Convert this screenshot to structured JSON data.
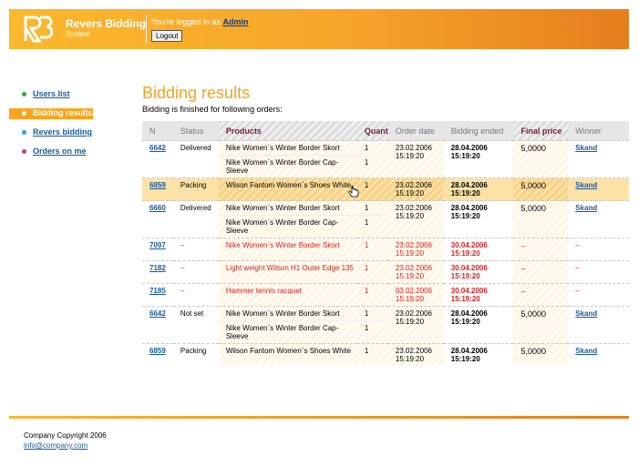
{
  "header": {
    "brand_title": "Revers Bidding",
    "brand_subtitle": "System",
    "logged_in_prefix": "You're logged in as",
    "user": "Admin",
    "logout_label": "Logout"
  },
  "nav": {
    "items": [
      {
        "label": "Users list",
        "color": "#3aa63a"
      },
      {
        "label": "Bidding results",
        "color": "#ffffff",
        "active": true
      },
      {
        "label": "Revers bidding",
        "color": "#2aa7d8"
      },
      {
        "label": "Orders on me",
        "color": "#a5479c"
      }
    ]
  },
  "main": {
    "title": "Bidding results",
    "subtitle": "Bidding is finished for following orders:",
    "columns": [
      "N",
      "Status",
      "Products",
      "Quant",
      "Order date",
      "Bidding ended",
      "Final price",
      "Winner"
    ]
  },
  "orders": [
    {
      "n": "6642",
      "status": "Delivered",
      "products": [
        "Nike Women`s Winter Border Skort",
        "Nike Women`s Winter Border Cap-Sleeve"
      ],
      "quant": [
        "1",
        "1"
      ],
      "order_date": "23.02.2006",
      "order_time": "15:19:20",
      "ended_date": "28.04.2006",
      "ended_time": "15:19:20",
      "price": "5,0000",
      "winner": "Skand"
    },
    {
      "n": "6859",
      "status": "Packing",
      "products": [
        "Wilson Fantom Women`s Shoes White"
      ],
      "quant": [
        "1"
      ],
      "order_date": "23.02.2006",
      "order_time": "15:19:20",
      "ended_date": "28.04.2006",
      "ended_time": "15:19:20",
      "price": "5,0000",
      "winner": "Skand",
      "selected": true
    },
    {
      "n": "6660",
      "status": "Delivered",
      "products": [
        "Nike Women`s Winter Border Skort",
        "Nike Women`s Winter Border Cap-Sleeve"
      ],
      "quant": [
        "1",
        "1"
      ],
      "order_date": "23.02.2006",
      "order_time": "15:19:20",
      "ended_date": "28.04.2006",
      "ended_time": "15:19:20",
      "price": "5,0000",
      "winner": "Skand"
    },
    {
      "n": "7097",
      "status": "–",
      "products": [
        "Nike Women`s Winter Border Skort"
      ],
      "quant": [
        "1"
      ],
      "order_date": "23.02.2006",
      "order_time": "15:19:20",
      "ended_date": "30.04.2006",
      "ended_time": "15:19:20",
      "price": "–",
      "winner": "–",
      "red": true
    },
    {
      "n": "7182",
      "status": "–",
      "products": [
        "Light weight Wilson H1 Outer Edge 135"
      ],
      "quant": [
        "1"
      ],
      "order_date": "23.02.2006",
      "order_time": "15:19:20",
      "ended_date": "30.04.2006",
      "ended_time": "15:19:20",
      "price": "–",
      "winner": "–",
      "red": true
    },
    {
      "n": "7185",
      "status": "–",
      "products": [
        "Hammer tennis racquet"
      ],
      "quant": [
        "1"
      ],
      "order_date": "03.02.2006",
      "order_time": "15:19:20",
      "ended_date": "30.04.2006",
      "ended_time": "15:19:20",
      "price": "–",
      "winner": "–",
      "red": true
    },
    {
      "n": "6642",
      "status": "Not set",
      "products": [
        "Nike Women`s Winter Border Skort",
        "Nike Women`s Winter Border Cap-Sleeve"
      ],
      "quant": [
        "1",
        "1"
      ],
      "order_date": "23.02.2006",
      "order_time": "15:19:20",
      "ended_date": "28.04.2006",
      "ended_time": "15:19:20",
      "price": "5,0000",
      "winner": "Skand"
    },
    {
      "n": "6859",
      "status": "Packing",
      "products": [
        "Wilson Fantom Women`s Shoes White"
      ],
      "quant": [
        "1"
      ],
      "order_date": "23.02.2006",
      "order_time": "15:19:20",
      "ended_date": "28.04.2006",
      "ended_time": "15:19:20",
      "price": "5,0000",
      "winner": "Skand"
    }
  ],
  "footer": {
    "copyright": "Company Copyright 2006",
    "email": "info@company.com"
  },
  "icons": {
    "logo": "rb-logo-icon",
    "cursor": "hand-pointer-icon"
  },
  "colors": {
    "accent": "#f5a21f",
    "selected_row": "#fde2a7",
    "red": "#d82020"
  }
}
